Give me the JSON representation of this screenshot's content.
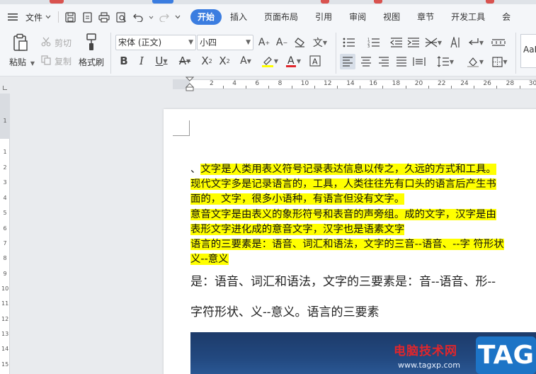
{
  "menu": {
    "file_label": "文件",
    "tabs": [
      "开始",
      "插入",
      "页面布局",
      "引用",
      "审阅",
      "视图",
      "章节",
      "开发工具",
      "会"
    ]
  },
  "ribbon": {
    "paste_label": "粘贴",
    "cut_label": "剪切",
    "copy_label": "复制",
    "format_painter_label": "格式刷",
    "font_name": "宋体 (正文)",
    "font_size": "小四",
    "style_preview": "AaB"
  },
  "ruler": {
    "numbers": [
      "2",
      "4",
      "6",
      "8",
      "10",
      "12",
      "14",
      "16",
      "18",
      "20",
      "22",
      "24",
      "26",
      "28",
      "30"
    ],
    "vertical_numbers": [
      "1",
      "1",
      "2",
      "3",
      "4",
      "5",
      "6",
      "7",
      "8",
      "9",
      "10",
      "11",
      "12",
      "13",
      "14",
      "15"
    ]
  },
  "document": {
    "lines": [
      {
        "pre": "、",
        "hl": "文字是人类用表义符号记录表达信息以传之，久远的方式和工具。"
      },
      {
        "pre": "",
        "hl": "现代文字多是记录语言的，工具，人类往往先有口头的语言后产生书"
      },
      {
        "pre": "",
        "hl": "面的，文字，很多小语种，有语言但没有文字。"
      },
      {
        "pre": "",
        "hl": "意音文字是由表义的象形符号和表音的声旁组。成的文字，汉字是由"
      },
      {
        "pre": "",
        "hl": "表形文字进化成的意音文字，汉字也是语素文字"
      },
      {
        "pre": "",
        "hl": "语言的三要素是：语音、词汇和语法，文字的三音--语音、--字 符形状"
      },
      {
        "pre": "",
        "hl": "义--意义"
      }
    ],
    "para2_line1": "是：语音、词汇和语法，文字的三要素是：音--语音、形--",
    "para2_line2": "字符形状、义--意义。语言的三要素"
  },
  "watermark": {
    "site_name": "电脑技术网",
    "url": "www.tagxp.com",
    "tag": "TAG"
  },
  "colors": {
    "accent": "#3b7de0",
    "highlight": "#ffff00",
    "watermark_red": "#e0262c",
    "tag_blue": "#1d74c6"
  }
}
